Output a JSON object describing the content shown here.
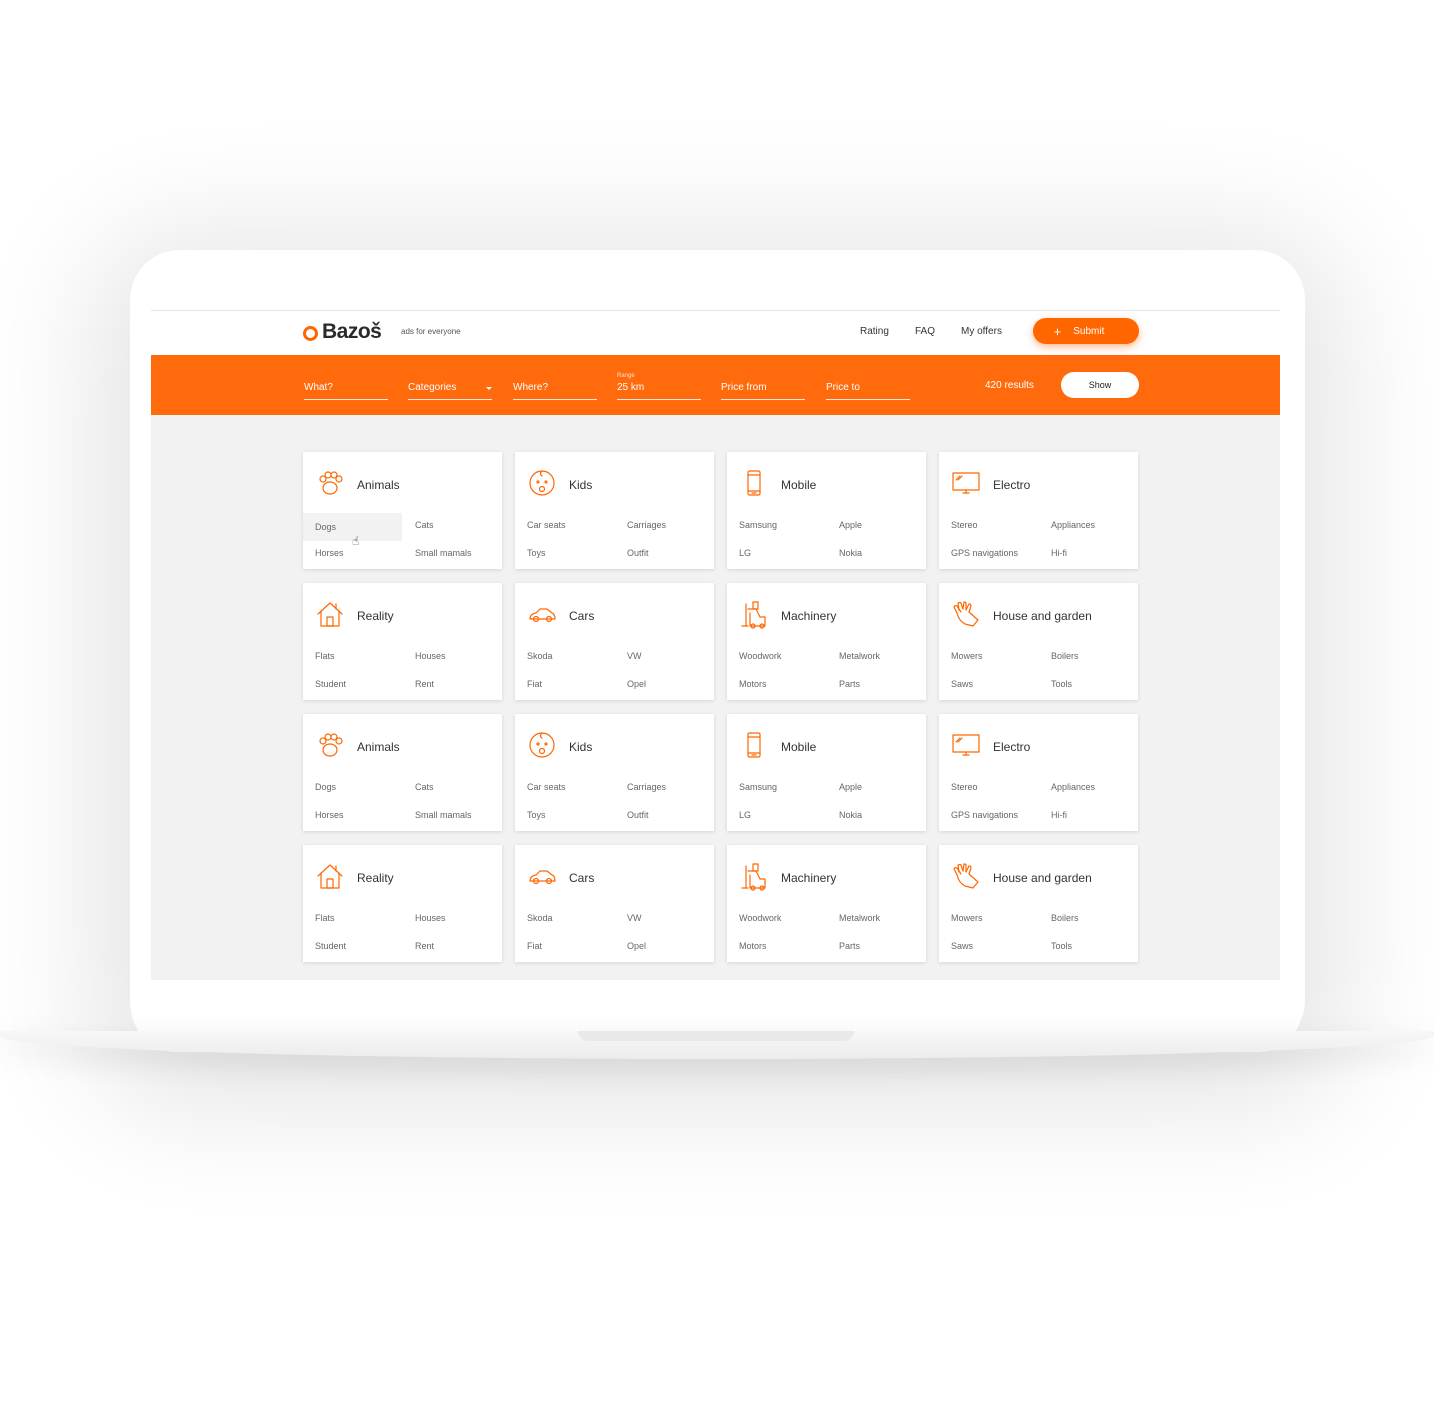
{
  "header": {
    "logo_text": "Bazoš",
    "tagline": "ads for everyone",
    "nav": [
      "Rating",
      "FAQ",
      "My offers"
    ],
    "submit_label": "Submit"
  },
  "search": {
    "what": "What?",
    "categories": "Categories",
    "where": "Where?",
    "range_label": "Range",
    "range_value": "25 km",
    "price_from": "Price from",
    "price_to": "Price to",
    "results": "420 results",
    "show_label": "Show"
  },
  "categories": [
    {
      "icon": "paw-icon",
      "title": "Animals",
      "items": [
        "Dogs",
        "Cats",
        "Horses",
        "Small mamals"
      ]
    },
    {
      "icon": "baby-icon",
      "title": "Kids",
      "items": [
        "Car seats",
        "Carriages",
        "Toys",
        "Outfit"
      ]
    },
    {
      "icon": "mobile-phone-icon",
      "title": "Mobile",
      "items": [
        "Samsung",
        "Apple",
        "LG",
        "Nokia"
      ]
    },
    {
      "icon": "tv-icon",
      "title": "Electro",
      "items": [
        "Stereo",
        "Appliances",
        "GPS navigations",
        "Hi-fi"
      ]
    },
    {
      "icon": "house-icon",
      "title": "Reality",
      "items": [
        "Flats",
        "Houses",
        "Student",
        "Rent"
      ]
    },
    {
      "icon": "car-icon",
      "title": "Cars",
      "items": [
        "Skoda",
        "VW",
        "Fiat",
        "Opel"
      ]
    },
    {
      "icon": "forklift-icon",
      "title": "Machinery",
      "items": [
        "Woodwork",
        "Metalwork",
        "Motors",
        "Parts"
      ]
    },
    {
      "icon": "glove-icon",
      "title": "House and garden",
      "items": [
        "Mowers",
        "Boilers",
        "Saws",
        "Tools"
      ]
    },
    {
      "icon": "paw-icon",
      "title": "Animals",
      "items": [
        "Dogs",
        "Cats",
        "Horses",
        "Small mamals"
      ]
    },
    {
      "icon": "baby-icon",
      "title": "Kids",
      "items": [
        "Car seats",
        "Carriages",
        "Toys",
        "Outfit"
      ]
    },
    {
      "icon": "mobile-phone-icon",
      "title": "Mobile",
      "items": [
        "Samsung",
        "Apple",
        "LG",
        "Nokia"
      ]
    },
    {
      "icon": "tv-icon",
      "title": "Electro",
      "items": [
        "Stereo",
        "Appliances",
        "GPS navigations",
        "Hi-fi"
      ]
    },
    {
      "icon": "house-icon",
      "title": "Reality",
      "items": [
        "Flats",
        "Houses",
        "Student",
        "Rent"
      ]
    },
    {
      "icon": "car-icon",
      "title": "Cars",
      "items": [
        "Skoda",
        "VW",
        "Fiat",
        "Opel"
      ]
    },
    {
      "icon": "forklift-icon",
      "title": "Machinery",
      "items": [
        "Woodwork",
        "Metalwork",
        "Motors",
        "Parts"
      ]
    },
    {
      "icon": "glove-icon",
      "title": "House and garden",
      "items": [
        "Mowers",
        "Boilers",
        "Saws",
        "Tools"
      ]
    }
  ],
  "colors": {
    "accent": "#ff6600",
    "panel": "#f2f2f2"
  }
}
